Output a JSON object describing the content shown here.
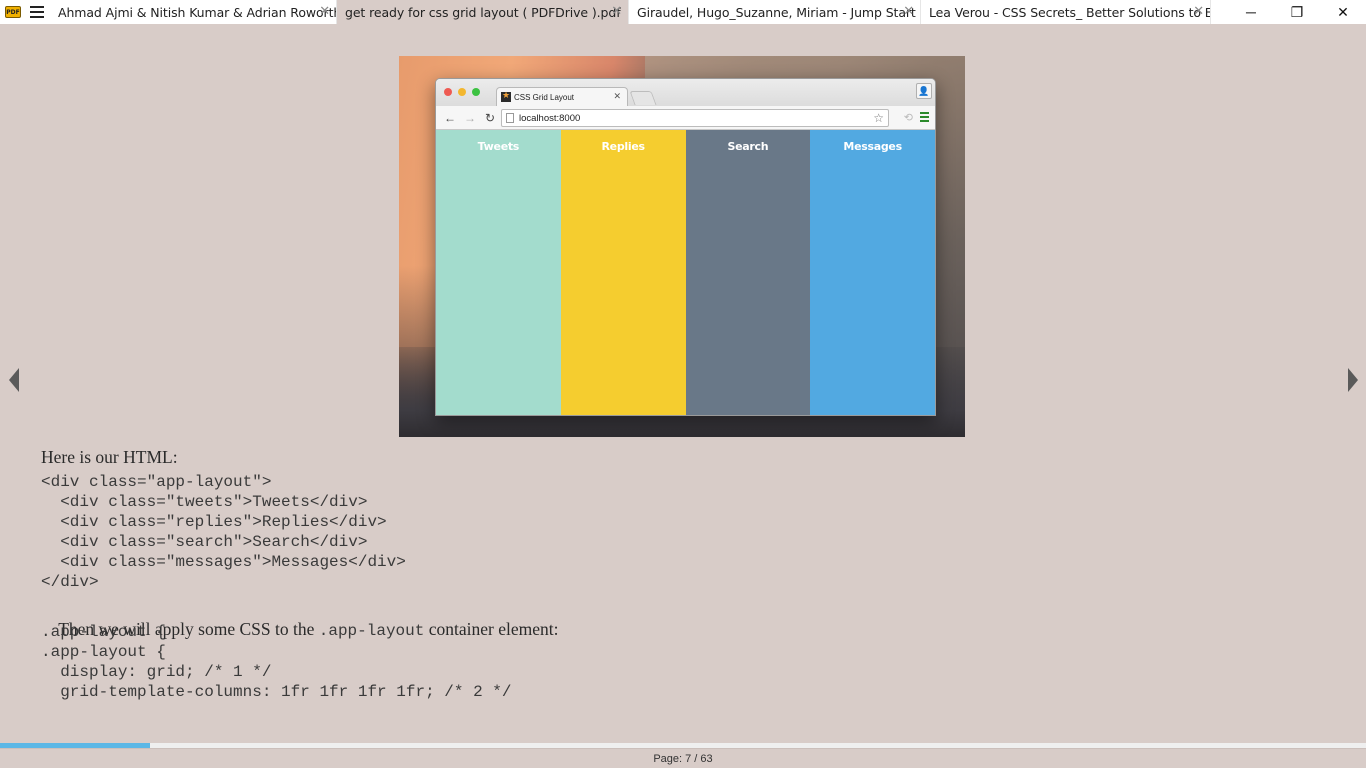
{
  "app": {
    "logo_text": "PDF"
  },
  "tabs": [
    {
      "label": "Ahmad Ajmi & Nitish Kumar & Adrian Roworth..."
    },
    {
      "label": "get ready for css grid layout ( PDFDrive ).pdf"
    },
    {
      "label": "Giraudel, Hugo_Suzanne, Miriam - Jump Start S..."
    },
    {
      "label": "Lea Verou - CSS Secrets_ Better Solutions to Ev..."
    }
  ],
  "active_tab_index": 1,
  "window_controls": {
    "minimize": "─",
    "restore": "❐",
    "close": "✕"
  },
  "figure": {
    "browser_tab_title": "CSS Grid Layout",
    "address": "localhost:8000",
    "columns": [
      {
        "label": "Tweets",
        "color": "#a3dccd"
      },
      {
        "label": "Replies",
        "color": "#f5cd2f"
      },
      {
        "label": "Search",
        "color": "#697888"
      },
      {
        "label": "Messages",
        "color": "#52a9e1"
      }
    ]
  },
  "content": {
    "intro_html": "Here is our HTML:",
    "html_code": [
      "<div class=\"app-layout\">",
      "  <div class=\"tweets\">Tweets</div>",
      "  <div class=\"replies\">Replies</div>",
      "  <div class=\"search\">Search</div>",
      "  <div class=\"messages\">Messages</div>",
      "</div>"
    ],
    "css_intro_before": "Then we will apply some CSS to the ",
    "css_intro_code": ".app-layout",
    "css_intro_after": " container element:",
    "css_code": [
      ".app-layout {",
      ".app-layout {",
      "  display: grid; /* 1 */",
      "  grid-template-columns: 1fr 1fr 1fr 1fr; /* 2 */"
    ]
  },
  "status": {
    "page_label": "Page: 7 / 63",
    "current_page": 7,
    "total_pages": 63,
    "progress_fraction": 0.11
  },
  "colors": {
    "page_bg": "#d8ccc8",
    "progress": "#5bb7e6"
  }
}
